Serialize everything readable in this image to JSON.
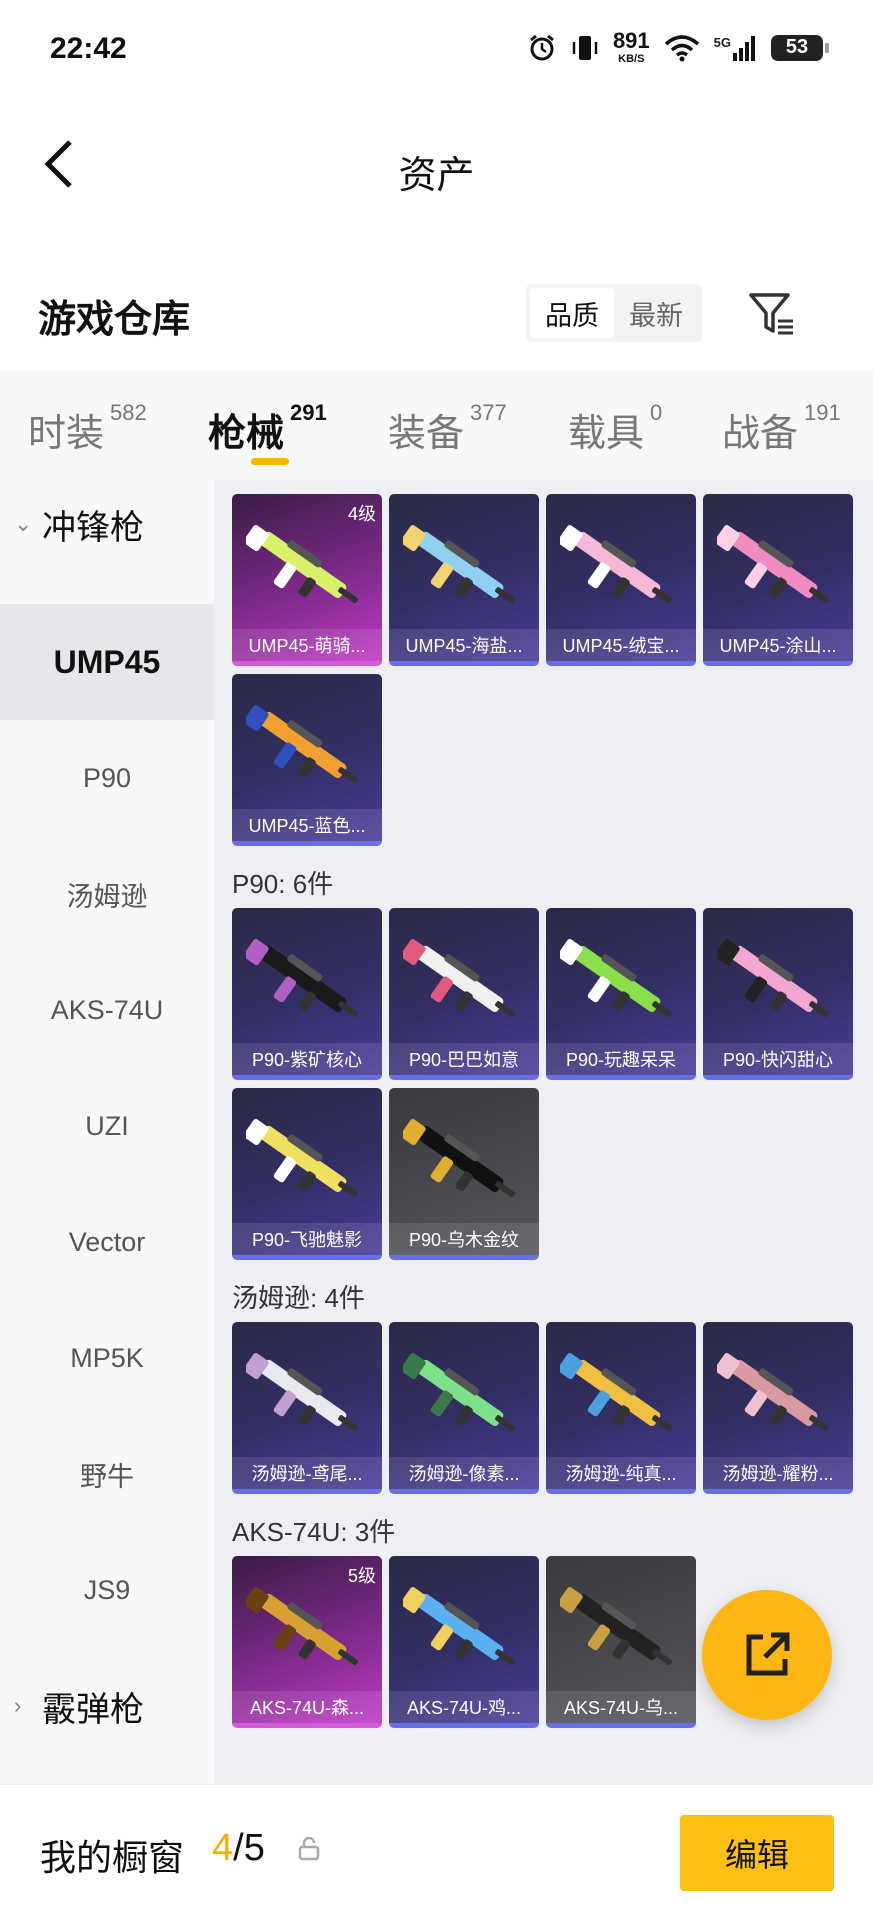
{
  "status_bar": {
    "time": "22:42",
    "net_speed": "891",
    "net_unit": "KB/S",
    "network": "5G",
    "battery": "53"
  },
  "header": {
    "title": "资产"
  },
  "warehouse": {
    "title": "游戏仓库",
    "sort_options": [
      "品质",
      "最新"
    ],
    "active_sort": "品质"
  },
  "tabs": [
    {
      "label": "时装",
      "count": "582"
    },
    {
      "label": "枪械",
      "count": "291"
    },
    {
      "label": "装备",
      "count": "377"
    },
    {
      "label": "载具",
      "count": "0"
    },
    {
      "label": "战备",
      "count": "191"
    }
  ],
  "active_tab": "枪械",
  "sidebar": {
    "group_expanded": "冲锋枪",
    "items": [
      "UMP45",
      "P90",
      "汤姆逊",
      "AKS-74U",
      "UZI",
      "Vector",
      "MP5K",
      "野牛",
      "JS9"
    ],
    "active_item": "UMP45",
    "group_collapsed": "霰弹枪"
  },
  "sections": [
    {
      "title": "",
      "items": [
        {
          "name": "UMP45-萌骑...",
          "level": "4级",
          "rarity": "legend"
        },
        {
          "name": "UMP45-海盐...",
          "level": "",
          "rarity": "epic"
        },
        {
          "name": "UMP45-绒宝...",
          "level": "",
          "rarity": "epic"
        },
        {
          "name": "UMP45-涂山...",
          "level": "",
          "rarity": "epic"
        },
        {
          "name": "UMP45-蓝色...",
          "level": "",
          "rarity": "epic"
        }
      ]
    },
    {
      "title": "P90: 6件",
      "items": [
        {
          "name": "P90-紫矿核心",
          "level": "",
          "rarity": "epic"
        },
        {
          "name": "P90-巴巴如意",
          "level": "",
          "rarity": "epic"
        },
        {
          "name": "P90-玩趣呆呆",
          "level": "",
          "rarity": "epic"
        },
        {
          "name": "P90-快闪甜心",
          "level": "",
          "rarity": "epic"
        },
        {
          "name": "P90-飞驰魅影",
          "level": "",
          "rarity": "epic"
        },
        {
          "name": "P90-乌木金纹",
          "level": "",
          "rarity": "grey"
        }
      ]
    },
    {
      "title": "汤姆逊: 4件",
      "items": [
        {
          "name": "汤姆逊-鸢尾...",
          "level": "",
          "rarity": "epic"
        },
        {
          "name": "汤姆逊-像素...",
          "level": "",
          "rarity": "epic"
        },
        {
          "name": "汤姆逊-纯真...",
          "level": "",
          "rarity": "epic"
        },
        {
          "name": "汤姆逊-耀粉...",
          "level": "",
          "rarity": "epic"
        }
      ]
    },
    {
      "title": "AKS-74U: 3件",
      "items": [
        {
          "name": "AKS-74U-森...",
          "level": "5级",
          "rarity": "legend"
        },
        {
          "name": "AKS-74U-鸡...",
          "level": "",
          "rarity": "epic"
        },
        {
          "name": "AKS-74U-乌...",
          "level": "",
          "rarity": "grey"
        }
      ]
    }
  ],
  "bottom": {
    "showcase_label": "我的橱窗",
    "showcase_current": "4",
    "showcase_total": "/5",
    "edit_label": "编辑"
  },
  "colors": {
    "accent": "#f7b500",
    "epic_border": "#6a6ee6",
    "legend_bg": "#c03ac6"
  }
}
